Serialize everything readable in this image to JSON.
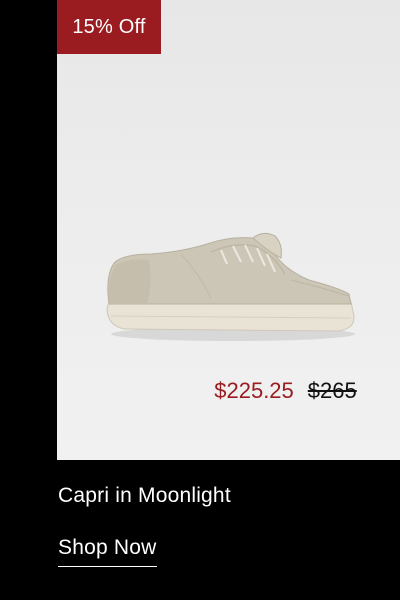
{
  "promo": {
    "badge_text": "15% Off",
    "badge_color": "#9b1c20"
  },
  "product": {
    "name": "Capri in Moonlight",
    "image_icon": "sneaker-image",
    "price_sale": "$225.25",
    "price_original": "$265",
    "sale_color": "#9b1c20"
  },
  "cta": {
    "label": "Shop Now"
  }
}
